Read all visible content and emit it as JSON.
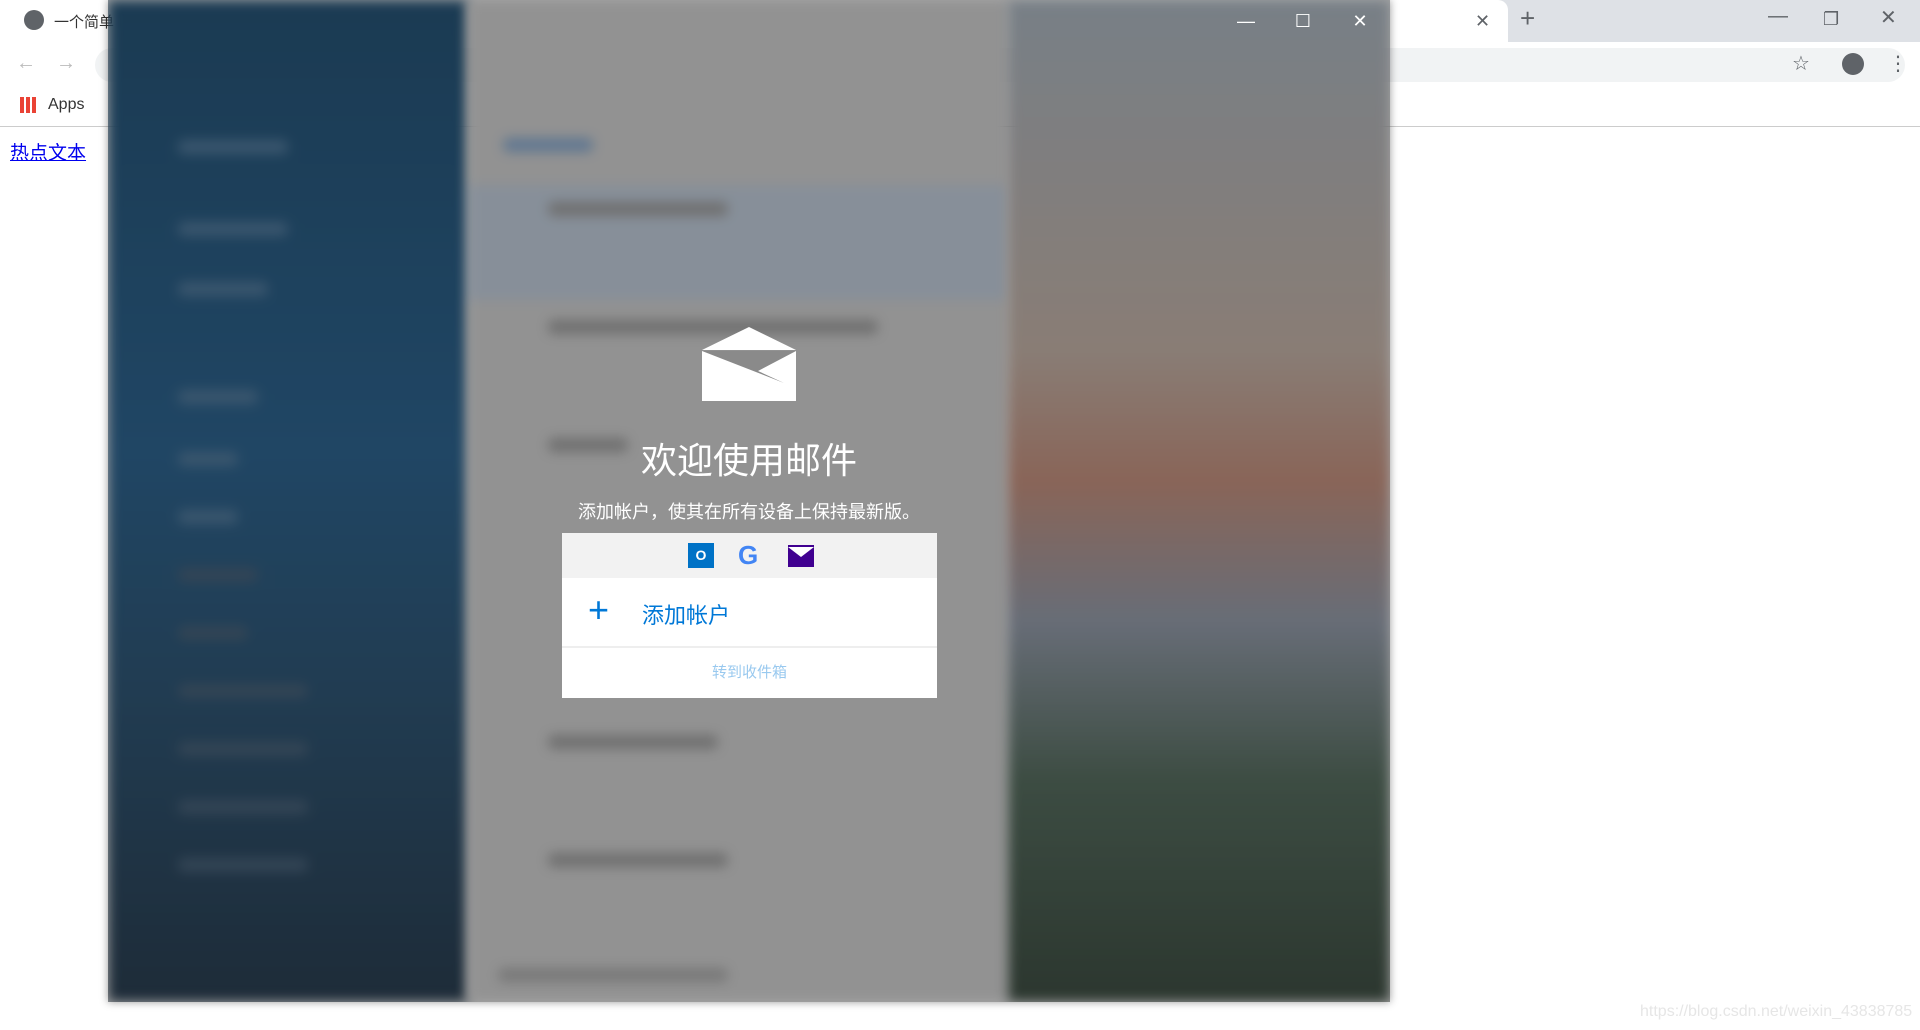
{
  "browser": {
    "tab_title": "一个简单",
    "bookmarks": {
      "apps_label": "Apps"
    },
    "icons": {
      "globe": "globe-icon",
      "back": "back-arrow-icon",
      "forward": "forward-arrow-icon",
      "reload": "reload-icon",
      "star": "bookmark-star-icon",
      "profile": "account-circle-icon",
      "menu": "more-vert-icon",
      "close_tab": "close-icon",
      "new_tab": "plus-icon"
    }
  },
  "page": {
    "link_text": "热点文本",
    "watermark": "https://blog.csdn.net/weixin_43838785"
  },
  "mail_app": {
    "welcome_title": "欢迎使用邮件",
    "welcome_subtitle": "添加帐户，使其在所有设备上保持最新版。",
    "providers": [
      "outlook-icon",
      "google-icon",
      "yahoo-mail-icon"
    ],
    "add_account_label": "添加帐户",
    "go_to_inbox_label": "转到收件箱",
    "accent": "#0078d7"
  }
}
